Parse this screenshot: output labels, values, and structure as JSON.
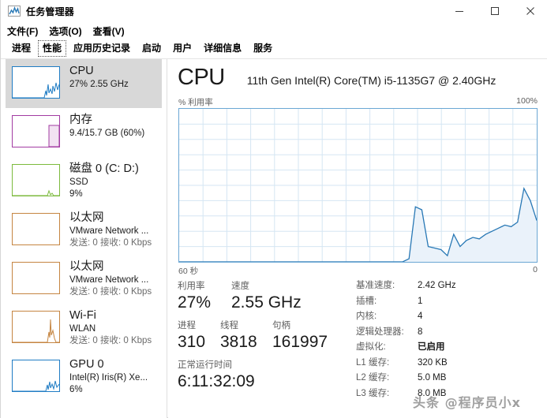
{
  "window": {
    "title": "任务管理器",
    "icon": "task-manager-chart-icon",
    "controls": {
      "minimize": "–",
      "maximize": "□",
      "close": "✕"
    }
  },
  "menu": [
    {
      "label": "文件(F)",
      "accel": "F"
    },
    {
      "label": "选项(O)",
      "accel": "O"
    },
    {
      "label": "查看(V)",
      "accel": "V"
    }
  ],
  "tabs": [
    {
      "label": "进程",
      "selected": false
    },
    {
      "label": "性能",
      "selected": true
    },
    {
      "label": "应用历史记录",
      "selected": false
    },
    {
      "label": "启动",
      "selected": false
    },
    {
      "label": "用户",
      "selected": false
    },
    {
      "label": "详细信息",
      "selected": false
    },
    {
      "label": "服务",
      "selected": false
    }
  ],
  "sidebar": {
    "items": [
      {
        "name": "cpu",
        "title": "CPU",
        "sub1": "27% 2.55 GHz",
        "sub2": "",
        "sub3": "",
        "color": "#1f7cc4",
        "selected": true
      },
      {
        "name": "memory",
        "title": "内存",
        "sub1": "9.4/15.7 GB (60%)",
        "sub2": "",
        "sub3": "",
        "color": "#a23ba2",
        "selected": false
      },
      {
        "name": "disk-0",
        "title": "磁盘 0 (C: D:)",
        "sub1": "SSD",
        "sub2": "9%",
        "sub3": "",
        "color": "#7cba3d",
        "selected": false
      },
      {
        "name": "ethernet-1",
        "title": "以太网",
        "sub1": "VMware Network ...",
        "sub2": "发送: 0 接收: 0 Kbps",
        "sub3": "",
        "color": "#c58541",
        "selected": false
      },
      {
        "name": "ethernet-2",
        "title": "以太网",
        "sub1": "VMware Network ...",
        "sub2": "发送: 0 接收: 0 Kbps",
        "sub3": "",
        "color": "#c58541",
        "selected": false
      },
      {
        "name": "wifi",
        "title": "Wi-Fi",
        "sub1": "WLAN",
        "sub2": "发送: 0 接收: 0 Kbps",
        "sub3": "",
        "color": "#c58541",
        "selected": false
      },
      {
        "name": "gpu-0",
        "title": "GPU 0",
        "sub1": "Intel(R) Iris(R) Xe...",
        "sub2": "6%",
        "sub3": "",
        "color": "#1f7cc4",
        "selected": false
      }
    ]
  },
  "main": {
    "heading": "CPU",
    "model": "11th Gen Intel(R) Core(TM) i5-1135G7 @ 2.40GHz",
    "graph": {
      "y_axis_label": "% 利用率",
      "y_max_label": "100%",
      "x_left_label": "60 秒",
      "x_right_label": "0",
      "line_color": "#2878b5",
      "fill_color": "#eaf2fa",
      "grid_color": "#d5e6f3"
    },
    "stats": {
      "utilization_label": "利用率",
      "utilization_value": "27%",
      "speed_label": "速度",
      "speed_value": "2.55 GHz",
      "processes_label": "进程",
      "processes_value": "310",
      "threads_label": "线程",
      "threads_value": "3818",
      "handles_label": "句柄",
      "handles_value": "161997",
      "uptime_label": "正常运行时间",
      "uptime_value": "6:11:32:09"
    },
    "specs": [
      {
        "key": "基准速度:",
        "value": "2.42 GHz",
        "bold": false
      },
      {
        "key": "插槽:",
        "value": "1",
        "bold": false
      },
      {
        "key": "内核:",
        "value": "4",
        "bold": false
      },
      {
        "key": "逻辑处理器:",
        "value": "8",
        "bold": false
      },
      {
        "key": "虚拟化:",
        "value": "已启用",
        "bold": true
      },
      {
        "key": "L1 缓存:",
        "value": "320 KB",
        "bold": false
      },
      {
        "key": "L2 缓存:",
        "value": "5.0 MB",
        "bold": false
      },
      {
        "key": "L3 缓存:",
        "value": "8.0 MB",
        "bold": false
      }
    ]
  },
  "watermark": "头条 @程序员小x",
  "chart_data": {
    "type": "area",
    "title": "CPU 利用率",
    "xlabel": "60 秒",
    "ylabel": "% 利用率",
    "ylim": [
      0,
      100
    ],
    "xlim": [
      60,
      0
    ],
    "grid": true,
    "series": [
      {
        "name": "% 利用率",
        "color": "#2878b5",
        "x": [
          60,
          48,
          44,
          42,
          41,
          40,
          39,
          38,
          37,
          36,
          35,
          34,
          33,
          32,
          31,
          30,
          29,
          28,
          27,
          26,
          25,
          24,
          23,
          22,
          21,
          20,
          19,
          18,
          17,
          16,
          15,
          14,
          13,
          12,
          11,
          10,
          9,
          8,
          7,
          6,
          5,
          4,
          3,
          2,
          1,
          0
        ],
        "values": [
          0,
          0,
          0,
          0,
          0,
          0,
          0,
          0,
          0,
          0,
          0,
          0,
          0,
          0,
          0,
          0,
          0,
          0,
          0,
          0,
          0,
          0,
          0,
          0,
          0,
          0,
          0,
          0,
          0,
          0,
          0,
          0,
          0,
          0,
          0,
          0,
          2,
          36,
          34,
          10,
          9,
          8,
          4,
          18,
          10,
          14,
          16,
          15,
          18,
          20,
          22,
          24,
          23,
          26,
          48,
          40,
          27
        ]
      }
    ]
  }
}
